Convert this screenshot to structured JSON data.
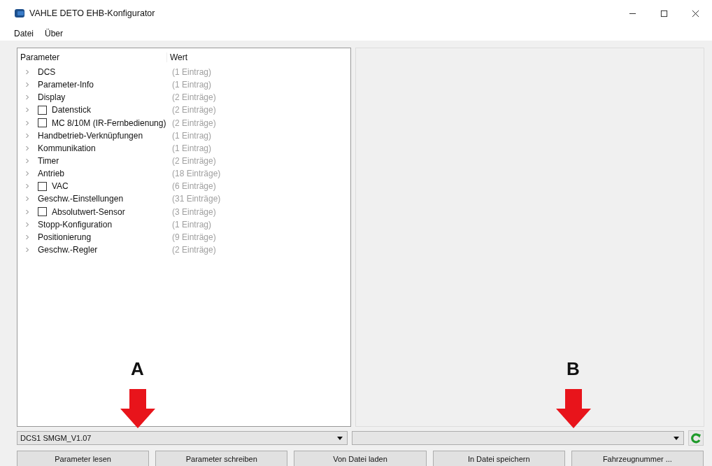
{
  "window": {
    "title": "VAHLE DETO EHB-Konfigurator"
  },
  "menu": [
    "Datei",
    "Über"
  ],
  "tree": {
    "columns": [
      "Parameter",
      "Wert"
    ],
    "rows": [
      {
        "kind": "plain",
        "label": "DCS",
        "value": "(1 Eintrag)",
        "expanded": false
      },
      {
        "kind": "plain",
        "label": "Parameter-Info",
        "value": "(1 Eintrag)",
        "expanded": false
      },
      {
        "kind": "plain",
        "label": "Display",
        "value": "(2 Einträge)",
        "expanded": false
      },
      {
        "kind": "checkbox",
        "label": "Datenstick",
        "value": "(2 Einträge)",
        "expanded": false,
        "checked": false
      },
      {
        "kind": "checkbox",
        "label": "MC 8/10M (IR-Fernbedienung)",
        "value": "(2 Einträge)",
        "expanded": false,
        "checked": false
      },
      {
        "kind": "plain",
        "label": "Handbetrieb-Verknüpfungen",
        "value": "(1 Eintrag)",
        "expanded": false
      },
      {
        "kind": "plain",
        "label": "Kommunikation",
        "value": "(1 Eintrag)",
        "expanded": false
      },
      {
        "kind": "plain",
        "label": "Timer",
        "value": "(2 Einträge)",
        "expanded": false
      },
      {
        "kind": "plain",
        "label": "Antrieb",
        "value": "(18 Einträge)",
        "expanded": false
      },
      {
        "kind": "checkbox",
        "label": "VAC",
        "value": "(6 Einträge)",
        "expanded": false,
        "checked": false
      },
      {
        "kind": "plain",
        "label": "Geschw.-Einstellungen",
        "value": "(31 Einträge)",
        "expanded": false
      },
      {
        "kind": "checkbox",
        "label": "Absolutwert-Sensor",
        "value": "(3 Einträge)",
        "expanded": false,
        "checked": false
      },
      {
        "kind": "plain",
        "label": "Stopp-Konfiguration",
        "value": "(1 Eintrag)",
        "expanded": false
      },
      {
        "kind": "plain",
        "label": "Positionierung",
        "value": "(9 Einträge)",
        "expanded": false
      },
      {
        "kind": "plain",
        "label": "Geschw.-Regler",
        "value": "(2 Einträge)",
        "expanded": false
      }
    ]
  },
  "device_select": {
    "value": "DCS1 SMGM_V1.07"
  },
  "buttons": [
    "Parameter lesen",
    "Parameter schreiben",
    "Von Datei laden",
    "In Datei speichern",
    "Fahrzeugnummer ..."
  ],
  "annotations": [
    {
      "label": "A"
    },
    {
      "label": "B"
    }
  ]
}
